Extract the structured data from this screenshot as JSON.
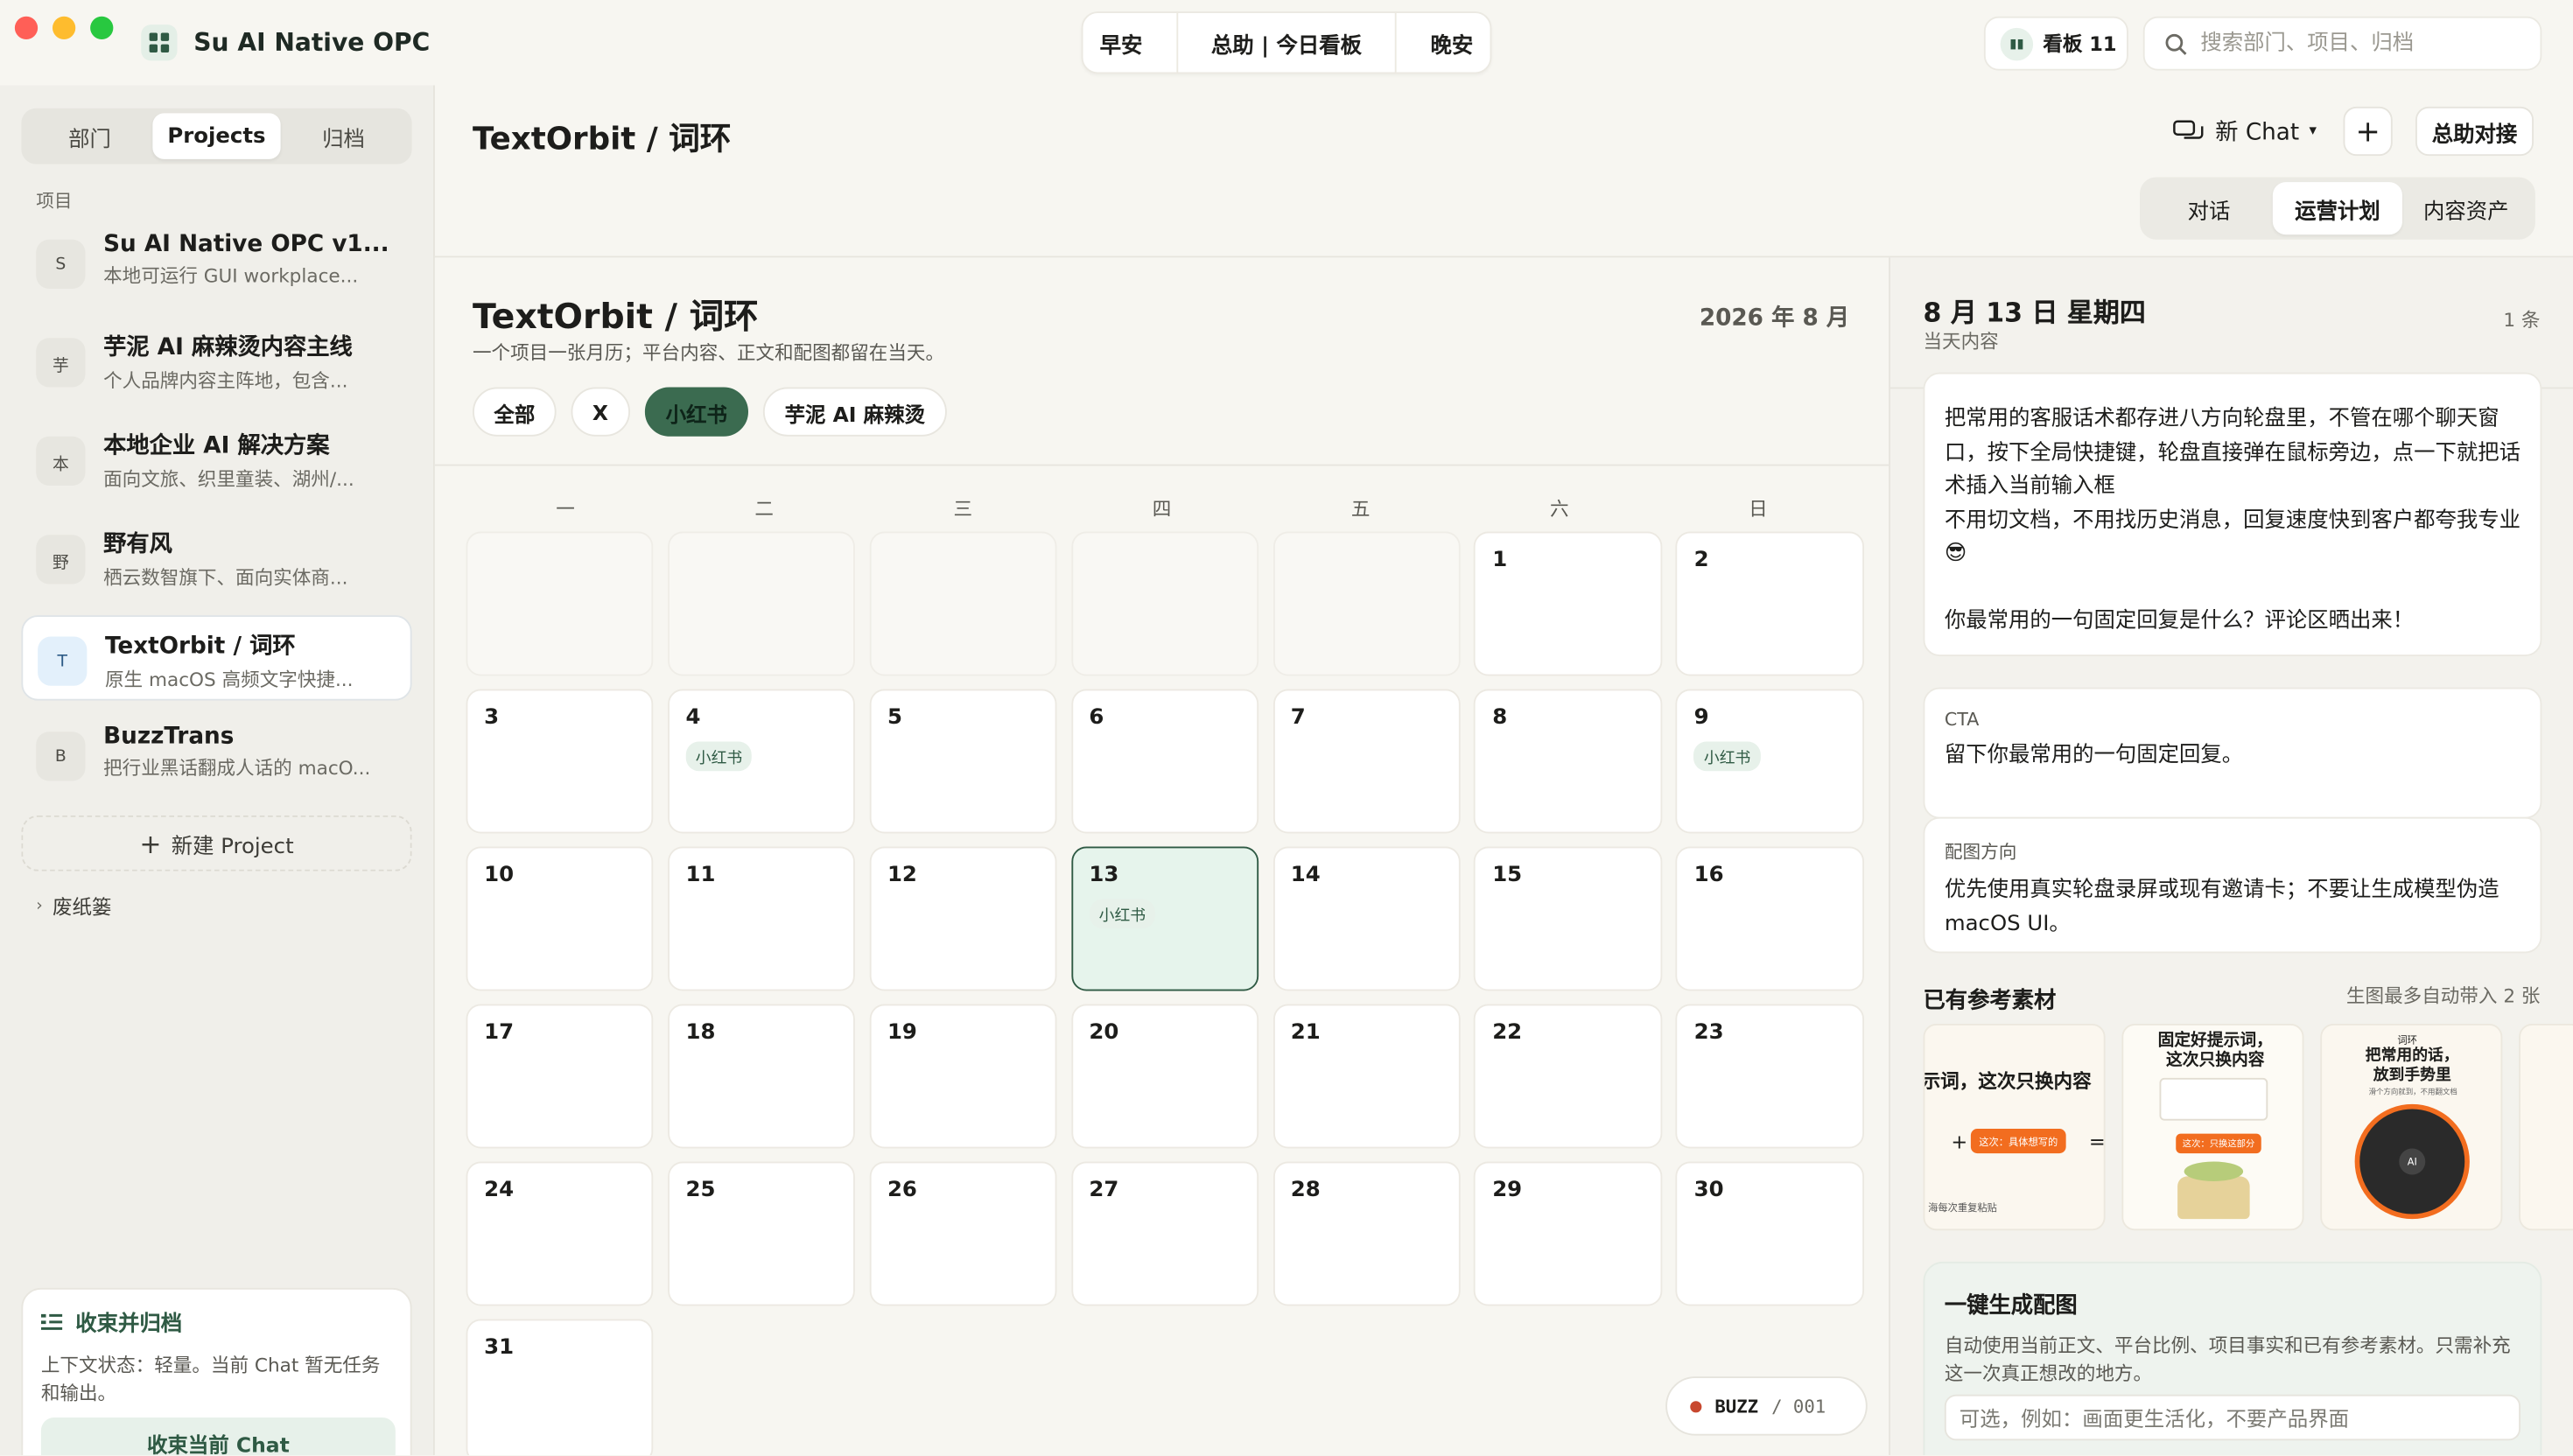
{
  "app": {
    "title": "Su AI Native OPC"
  },
  "top_nav": {
    "items": [
      "早安",
      "总助 | 今日看板",
      "晚安"
    ]
  },
  "board_pill": {
    "label": "看板 11"
  },
  "search": {
    "placeholder": "搜索部门、项目、归档"
  },
  "sidebar": {
    "tabs": [
      "部门",
      "Projects",
      "归档"
    ],
    "active_tab": "Projects",
    "section_label": "项目",
    "projects": [
      {
        "initial": "S",
        "name": "Su AI Native OPC v1...",
        "desc": "本地可运行 GUI workplace..."
      },
      {
        "initial": "芋",
        "name": "芋泥 AI 麻辣烫内容主线",
        "desc": "个人品牌内容主阵地，包含..."
      },
      {
        "initial": "本",
        "name": "本地企业 AI 解决方案",
        "desc": "面向文旅、织里童装、湖州/..."
      },
      {
        "initial": "野",
        "name": "野有风",
        "desc": "栖云数智旗下、面向实体商..."
      },
      {
        "initial": "T",
        "name": "TextOrbit / 词环",
        "desc": "原生 macOS 高频文字快捷...",
        "active": true
      },
      {
        "initial": "B",
        "name": "BuzzTrans",
        "desc": "把行业黑话翻成人话的 macO..."
      }
    ],
    "new_project": "新建 Project",
    "trash": "废纸篓",
    "archive": {
      "title": "收束并归档",
      "body": "上下文状态：轻量。当前 Chat 暂无任务和输出。",
      "button": "收束当前 Chat"
    }
  },
  "header": {
    "title": "TextOrbit / 词环",
    "new_chat": "新 Chat",
    "plus": "+",
    "handoff": "总助对接",
    "views": [
      "对话",
      "运营计划",
      "内容资产"
    ],
    "active_view": "运营计划"
  },
  "calendar": {
    "title": "TextOrbit / 词环",
    "subtitle": "一个项目一张月历；平台内容、正文和配图都留在当天。",
    "month": "2026 年 8 月",
    "filters": [
      "全部",
      "X",
      "小红书",
      "芋泥 AI 麻辣烫"
    ],
    "active_filter": "小红书",
    "weekdays": [
      "一",
      "二",
      "三",
      "四",
      "五",
      "六",
      "日"
    ],
    "leading_blanks": 5,
    "days": 31,
    "today": 13,
    "tags": {
      "4": "小红书",
      "9": "小红书",
      "13": "小红书"
    },
    "buzz": {
      "label": "BUZZ",
      "count": "/ 001"
    }
  },
  "detail": {
    "date": "8 月 13 日 星期四",
    "sub": "当天内容",
    "count": "1 条",
    "body_text": "把常用的客服话术都存进八方向轮盘里，不管在哪个聊天窗口，按下全局快捷键，轮盘直接弹在鼠标旁边，点一下就把话术插入当前输入框\n不用切文档，不用找历史消息，回复速度快到客户都夸我专业😎\n\n你最常用的一句固定回复是什么？评论区晒出来！",
    "cta": {
      "label": "CTA",
      "text": "留下你最常用的一句固定回复。"
    },
    "art": {
      "label": "配图方向",
      "text": "优先使用真实轮盘录屏或现有邀请卡；不要让生成模型伪造 macOS UI。"
    },
    "refs": {
      "title": "已有参考素材",
      "note": "生图最多自动带入 2 张",
      "thumbs": [
        {
          "title": "示词，这次只换内容",
          "chip": "这次：具体想写的",
          "foot": "海每次重复粘贴"
        },
        {
          "title": "固定好提示词，这次只换内容",
          "chip": "这次：只换这部分"
        },
        {
          "brand": "词环",
          "title": "把常用的话，放到手势里",
          "sub": "滑个方向就到，不用翻文档",
          "center": "AI"
        }
      ]
    },
    "generate": {
      "title": "一键生成配图",
      "desc": "自动使用当前正文、平台比例、项目事实和已有参考素材。只需补充这一次真正想改的地方。",
      "placeholder": "可选，例如：画面更生活化，不要产品界面"
    }
  }
}
